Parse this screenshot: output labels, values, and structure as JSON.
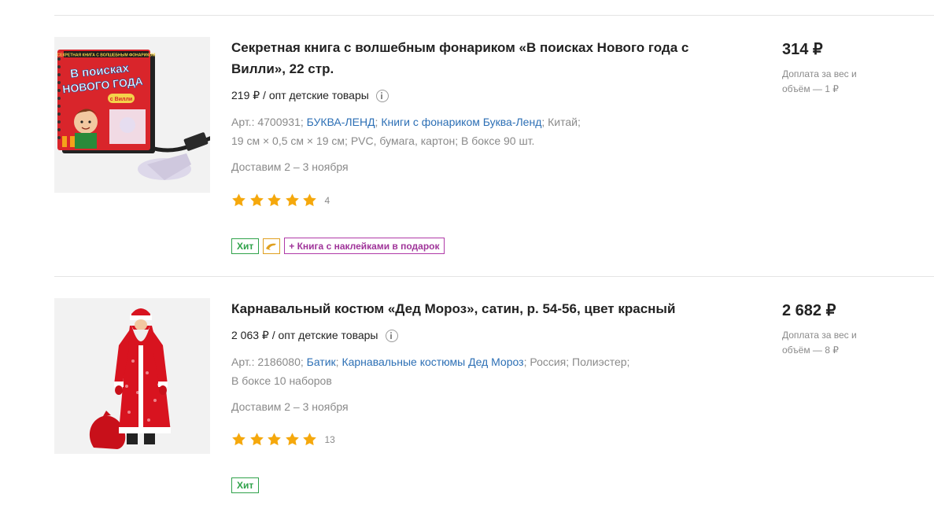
{
  "products": [
    {
      "title": "Секретная книга с волшебным фонариком «В поисках Нового года с Вилли», 22 стр.",
      "opt_price": "219 ₽ / опт детские товары",
      "art": "Арт.: 4700931;",
      "brand": "БУКВА-ЛЕНД",
      "series": "Книги с фонариком Буква-Ленд",
      "country": "Китай;",
      "size": "19 см × 0,5 см × 19 см;",
      "material": "PVC, бумага, картон;",
      "pack": "В боксе 90 шт.",
      "delivery": "Доставим 2 – 3 ноября",
      "rating": 5,
      "reviews": "4",
      "badge_hit": "Хит",
      "badge_gift": "+ Книга с наклейками в подарок",
      "price": "314 ₽",
      "surcharge": "Доплата за вес и объём — 1 ₽",
      "image": {
        "book_header": "СЕКРЕТНАЯ КНИГА С ВОЛШЕБНЫМ ФОНАРИКОМ",
        "book_line1": "В поисках",
        "book_line2": "НОВОГО ГОДА",
        "book_line3": "с Вилли"
      }
    },
    {
      "title": "Карнавальный костюм «Дед Мороз», сатин, р. 54-56, цвет красный",
      "opt_price": "2 063 ₽ / опт детские товары",
      "art": "Арт.: 2186080;",
      "brand": "Батик",
      "series": "Карнавальные костюмы Дед Мороз",
      "country": "Россия;",
      "material": "Полиэстер;",
      "pack": "В боксе 10 наборов",
      "delivery": "Доставим 2 – 3 ноября",
      "rating": 5,
      "reviews": "13",
      "badge_hit": "Хит",
      "price": "2 682 ₽",
      "surcharge": "Доплата за вес и объём — 8 ₽"
    }
  ],
  "colors": {
    "link": "#2c6fb5",
    "star": "#f5a80c",
    "hit": "#2fa24a",
    "gift": "#a0359a"
  }
}
